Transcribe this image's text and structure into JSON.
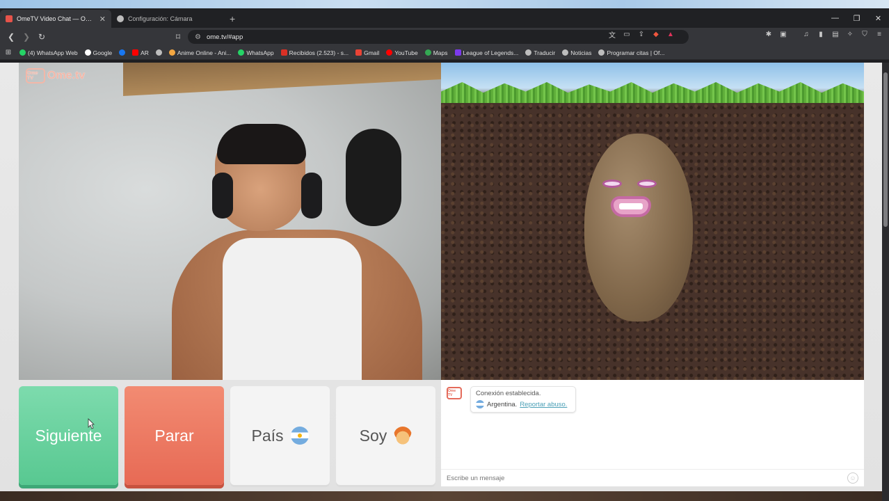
{
  "browser": {
    "tabs": [
      {
        "title": "OmeTV Video Chat — Omeg",
        "active": true,
        "favicon_color": "#e6534a"
      },
      {
        "title": "Configuración: Cámara",
        "active": false,
        "favicon_color": "#bdbdbd"
      }
    ],
    "new_tab": "+",
    "window_controls": {
      "minimize": "—",
      "restore": "❐",
      "close": "✕"
    },
    "url": "ome.tv/#app",
    "bookmarks": [
      {
        "label": "(4) WhatsApp Web",
        "color": "#25d366"
      },
      {
        "label": "Google",
        "color": "#ffffff"
      },
      {
        "label": "",
        "color": "#1877f2"
      },
      {
        "label": "AR",
        "color": "#ff0000"
      },
      {
        "label": "",
        "color": "#bdbdbd"
      },
      {
        "label": "Anime Online - Ani...",
        "color": "#f4a742"
      },
      {
        "label": "WhatsApp",
        "color": "#25d366"
      },
      {
        "label": "Recibidos (2.523) - s...",
        "color": "#d93025"
      },
      {
        "label": "Gmail",
        "color": "#ea4335"
      },
      {
        "label": "YouTube",
        "color": "#ff0000"
      },
      {
        "label": "Maps",
        "color": "#34a853"
      },
      {
        "label": "League of Legends...",
        "color": "#7c3aed"
      },
      {
        "label": "Traducir",
        "color": "#bdbdbd"
      },
      {
        "label": "Noticias",
        "color": "#bdbdbd"
      },
      {
        "label": "Programar citas | Of...",
        "color": "#bdbdbd"
      }
    ]
  },
  "app": {
    "logo": "Ome.tv",
    "logo_box": "Ome TV",
    "buttons": {
      "next": "Siguiente",
      "stop": "Parar",
      "country": "País",
      "gender": "Soy"
    },
    "chat": {
      "status": "Conexión establecida.",
      "country": "Argentina.",
      "report": "Reportar abuso.",
      "input_placeholder": "Escribe un mensaje"
    }
  }
}
